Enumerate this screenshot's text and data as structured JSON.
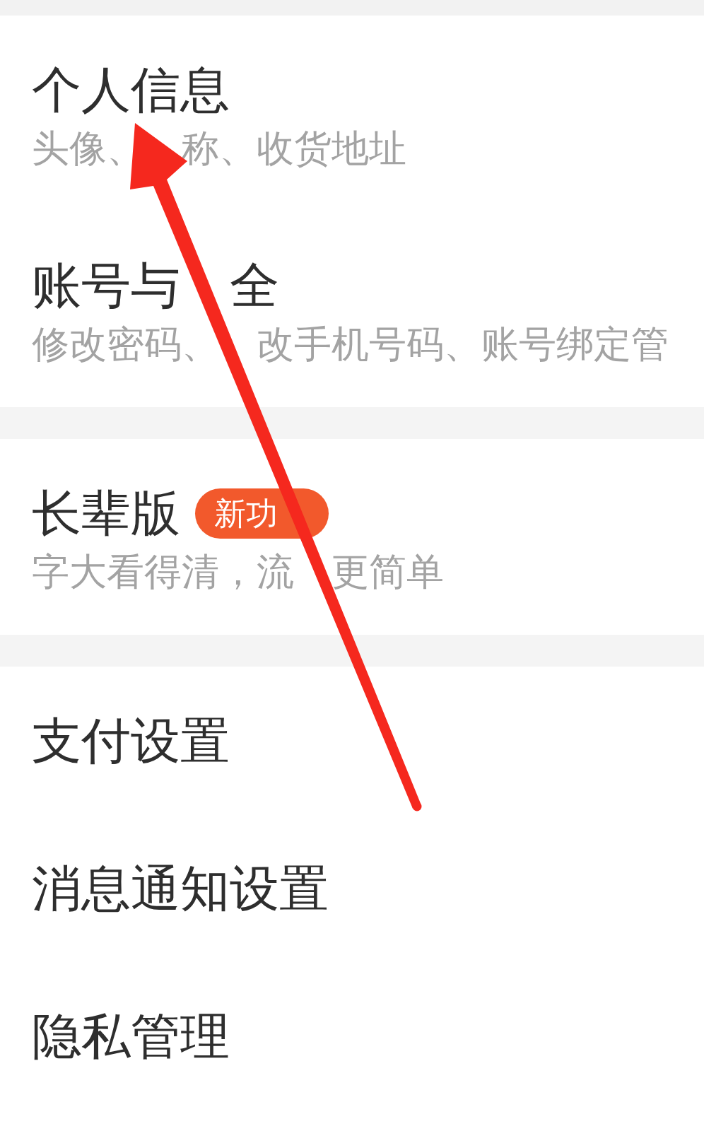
{
  "sections": [
    {
      "items": [
        {
          "title": [
            "个人信息"
          ],
          "subtitle": [
            "头像、",
            "称、收货地址"
          ]
        },
        {
          "title": [
            "账号与",
            "全"
          ],
          "subtitle": [
            "修改密码、",
            "改手机号码、账号绑定管"
          ]
        }
      ]
    },
    {
      "items": [
        {
          "title": [
            "长辈版"
          ],
          "badge": "新功",
          "subtitle": [
            "字大看得清，流",
            "更简单"
          ]
        }
      ]
    },
    {
      "items": [
        {
          "title": [
            "支付设置"
          ]
        },
        {
          "title": [
            "消息通知设置"
          ]
        },
        {
          "title": [
            "隐私管理"
          ]
        }
      ]
    }
  ]
}
